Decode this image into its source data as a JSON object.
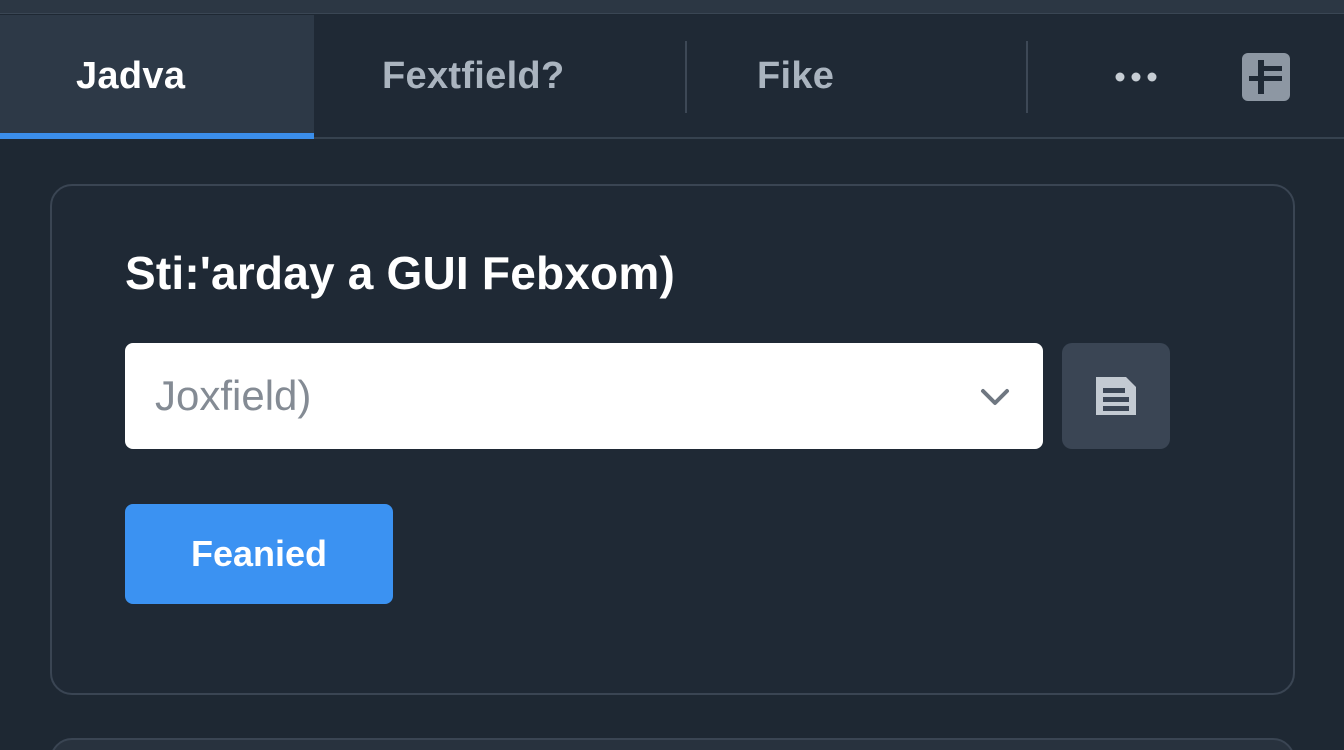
{
  "tabs": [
    {
      "label": "Jadva",
      "active": true
    },
    {
      "label": "Fextfield?",
      "active": false
    },
    {
      "label": "Fike",
      "active": false
    }
  ],
  "tabbar": {
    "more_icon": "more-horizontal-icon",
    "panel_icon": "panel-layout-icon"
  },
  "card": {
    "title": "Sti:'arday a GUI Febxom)",
    "dropdown": {
      "value": "Joxfield)",
      "chevron_icon": "chevron-down-icon"
    },
    "side_button_icon": "document-icon",
    "primary_button_label": "Feanied"
  },
  "colors": {
    "background": "#1e2833",
    "accent": "#3b92f2",
    "active_tab": "#2d3947",
    "border": "#3a4553"
  }
}
